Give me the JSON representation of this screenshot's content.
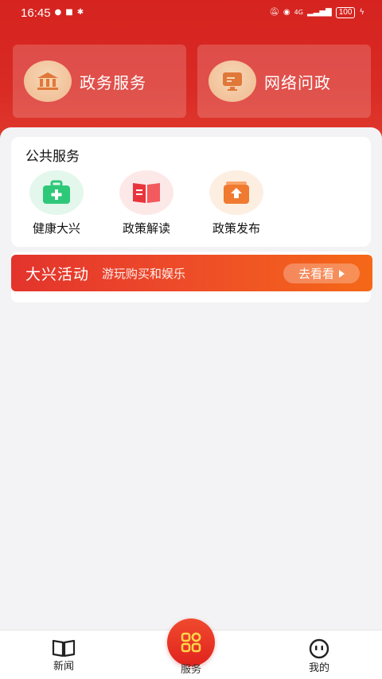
{
  "status_bar": {
    "time": "16:45",
    "network": "4G",
    "battery": "100"
  },
  "top_cards": [
    {
      "label": "政务服务",
      "icon": "government-building-icon"
    },
    {
      "label": "网络问政",
      "icon": "monitor-message-icon"
    }
  ],
  "public_services": {
    "title": "公共服务",
    "items": [
      {
        "label": "健康大兴",
        "icon": "medical-kit-icon",
        "color": "#2ec879"
      },
      {
        "label": "政策解读",
        "icon": "open-book-icon",
        "color": "#e8353b"
      },
      {
        "label": "政策发布",
        "icon": "upload-box-icon",
        "color": "#f07a30"
      }
    ]
  },
  "banner": {
    "title": "大兴活动",
    "subtitle": "游玩购买和娱乐",
    "button": "去看看"
  },
  "bottom_nav": {
    "news": "新闻",
    "service": "服务",
    "mine": "我的"
  },
  "colors": {
    "primary_red": "#d6231f",
    "banner_orange": "#f56817"
  }
}
